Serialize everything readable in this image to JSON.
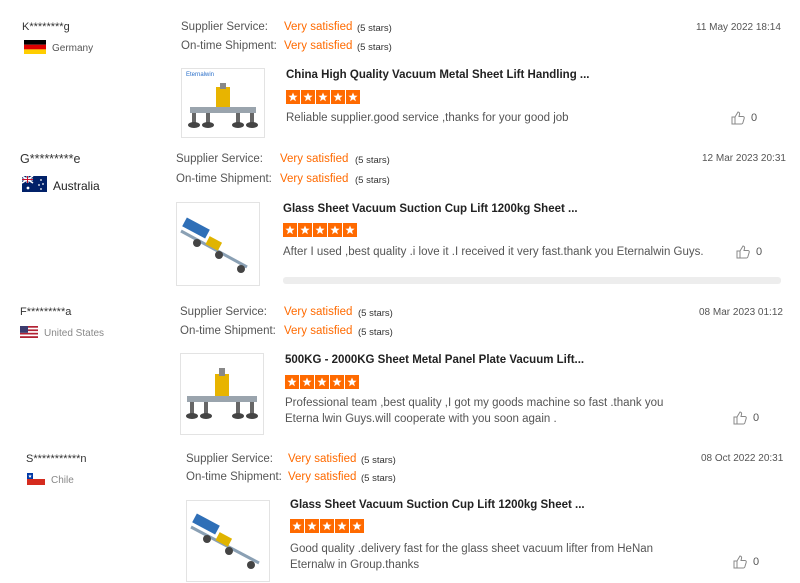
{
  "labels": {
    "service": "Supplier Service:",
    "shipment": "On-time Shipment:"
  },
  "accent_color": "#ff6a00",
  "reviews": [
    {
      "user": "K********g",
      "country": "Germany",
      "date": "11 May 2022 18:14",
      "service_value": "Very satisfied",
      "service_stars": "(5 stars)",
      "shipment_value": "Very satisfied",
      "shipment_stars": "(5 stars)",
      "product_title": "China High Quality Vacuum Metal Sheet Lift Handling ...",
      "thumb_brand": "Eternalwin",
      "rating": 5,
      "comment": "Reliable supplier.good service ,thanks for your good job",
      "likes": "0"
    },
    {
      "user": "G*********e",
      "country": "Australia",
      "date": "12 Mar 2023 20:31",
      "service_value": "Very satisfied",
      "service_stars": "(5 stars)",
      "shipment_value": "Very satisfied",
      "shipment_stars": "(5 stars)",
      "product_title": "Glass Sheet Vacuum Suction Cup Lift 1200kg Sheet ...",
      "rating": 5,
      "comment": "After I used ,best quality .i love it .I received it very fast.thank you Eternalwin Guys.",
      "likes": "0"
    },
    {
      "user": "F*********a",
      "country": "United States",
      "date": "08 Mar 2023 01:12",
      "service_value": "Very satisfied",
      "service_stars": "(5 stars)",
      "shipment_value": "Very satisfied",
      "shipment_stars": "(5 stars)",
      "product_title": "500KG - 2000KG Sheet Metal Panel Plate Vacuum Lift...",
      "rating": 5,
      "comment": "Professional team ,best quality ,I got my goods machine so fast .thank you Eterna lwin Guys.will cooperate with you soon again .",
      "likes": "0"
    },
    {
      "user": "S***********n",
      "country": "Chile",
      "date": "08 Oct 2022 20:31",
      "service_value": "Very satisfied",
      "service_stars": "(5 stars)",
      "shipment_value": "Very satisfied",
      "shipment_stars": "(5 stars)",
      "product_title": "Glass Sheet Vacuum Suction Cup Lift 1200kg Sheet ...",
      "rating": 5,
      "comment": "Good quality .delivery fast for the glass sheet vacuum lifter from HeNan  Eternalw in Group.thanks",
      "likes": "0"
    }
  ]
}
